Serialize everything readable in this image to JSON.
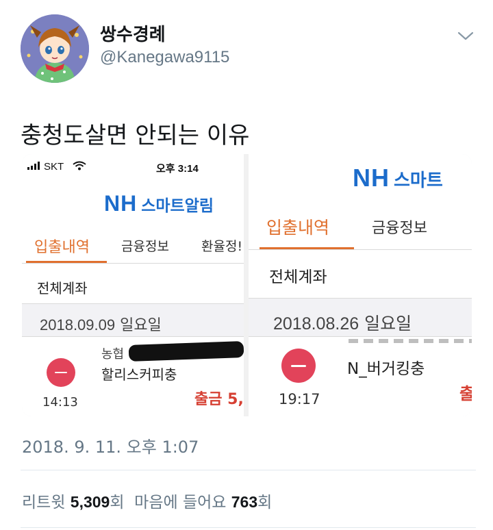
{
  "author": {
    "display_name": "쌍수경례",
    "handle": "@Kanegawa9115",
    "avatar_icon": "anime-girl-avatar"
  },
  "tweet": {
    "text": "충청도살면 안되는 이유",
    "timestamp": "2018. 9. 11. 오후 1:07"
  },
  "stats": {
    "retweet_label": "리트윗",
    "retweet_count": "5,309",
    "retweet_unit": "회",
    "like_label": "마음에 들어요",
    "like_count": "763",
    "like_unit": "회"
  },
  "media": {
    "left": {
      "carrier": "SKT",
      "time": "오후 3:14",
      "logo_nh": "NH",
      "logo_sub": "스마트알림",
      "tabs": [
        "입출내역",
        "금융정보",
        "환율정!"
      ],
      "account_label": "전체계좌",
      "date": "2018.09.09",
      "weekday": "일요일",
      "bank_line": "농협",
      "merchant": "할리스커피충",
      "time_label": "14:13",
      "withdraw_label": "출금 5,"
    },
    "right": {
      "logo_nh": "NH",
      "logo_sub": "스마트",
      "tabs": [
        "입출내역",
        "금융정보"
      ],
      "account_label": "전체계좌",
      "date": "2018.08.26",
      "weekday": "일요일",
      "merchant": "N_버거킹충",
      "time_label": "19:17",
      "withdraw_label": "출"
    }
  },
  "colors": {
    "accent_orange": "#e0702e",
    "nh_blue": "#1c6ccb",
    "minus_red": "#e2435a",
    "meta_gray": "#657786"
  }
}
